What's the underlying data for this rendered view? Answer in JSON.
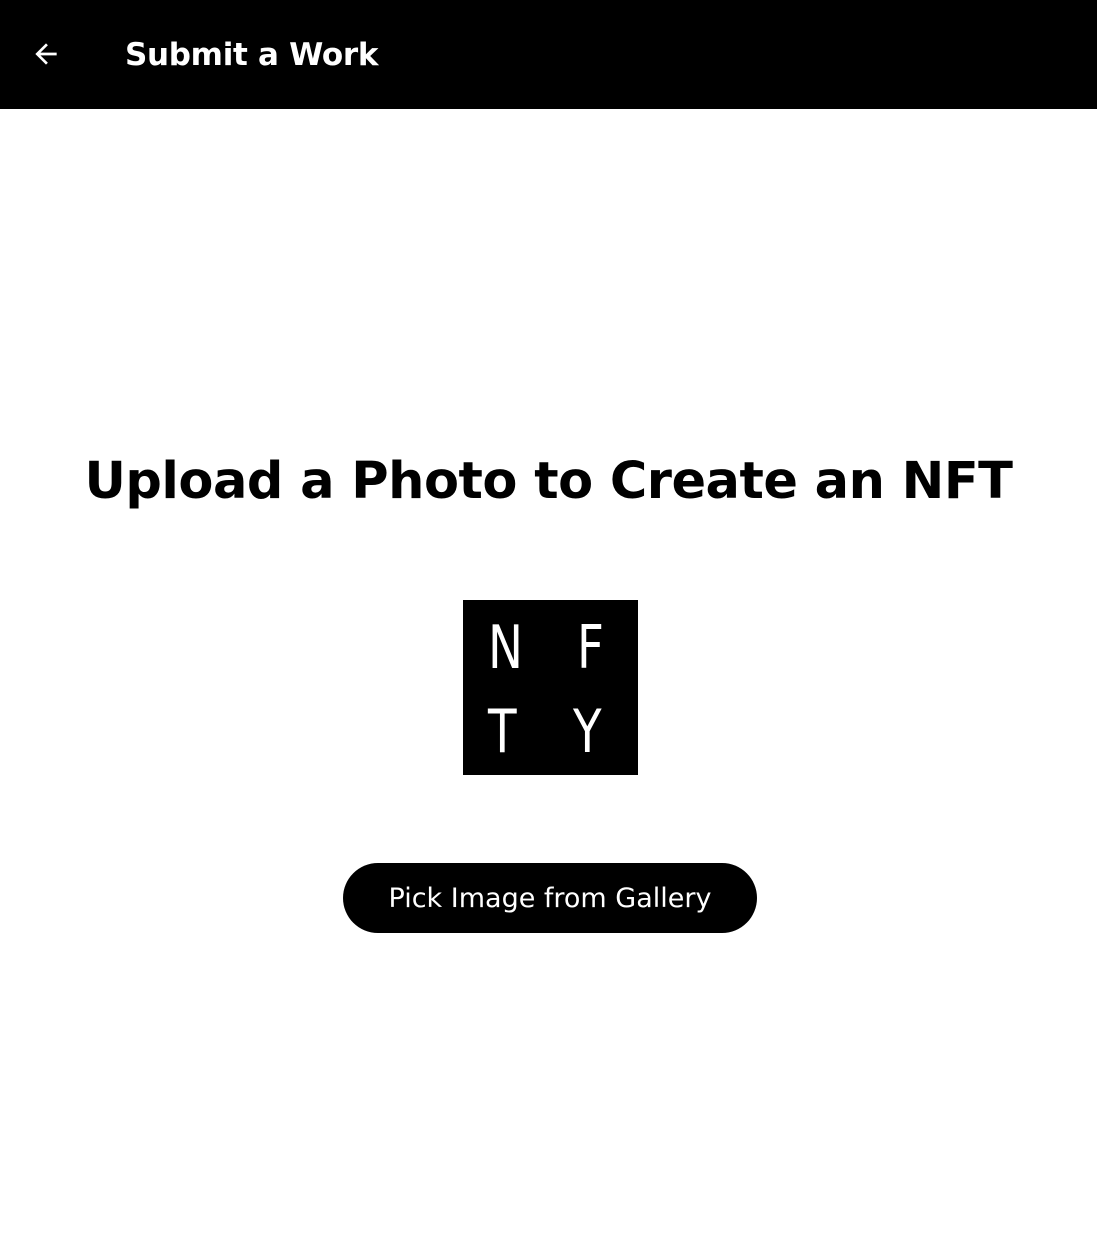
{
  "app_bar": {
    "back_icon": "arrow-left-icon",
    "title": "Submit a Work",
    "background": "#000000"
  },
  "main": {
    "heading": "Upload a Photo to Create an NFT",
    "logo": {
      "letters": [
        "N",
        "F",
        "T",
        "Y"
      ]
    },
    "pick_button_label": "Pick Image from Gallery"
  }
}
